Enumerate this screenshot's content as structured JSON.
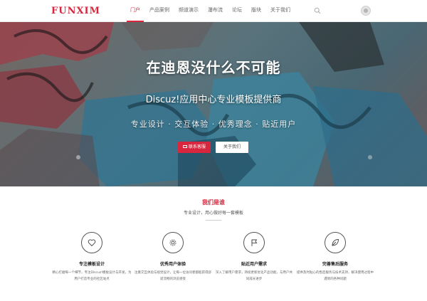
{
  "header": {
    "logo": "FUNXIM",
    "nav": [
      {
        "label": "门户",
        "active": true
      },
      {
        "label": "产品案例",
        "active": false
      },
      {
        "label": "频道演示",
        "active": false
      },
      {
        "label": "瀑布流",
        "active": false
      },
      {
        "label": "论坛",
        "active": false
      },
      {
        "label": "版块",
        "active": false
      },
      {
        "label": "关于我们",
        "active": false
      }
    ],
    "search_icon": "search-icon",
    "avatar_icon": "avatar"
  },
  "hero": {
    "title": "在迪恩没什么不可能",
    "subtitle": "Discuz!应用中心专业模板提供商",
    "tags": "专业设计 · 交互体验 · 优秀理念 · 贴近用户",
    "contact_button": "联系客服",
    "about_button": "关于我们"
  },
  "section": {
    "title": "我们是谁",
    "description": "专业设计，用心做好每一套模板",
    "features": [
      {
        "icon": "heart-icon",
        "title": "专注模板设计",
        "text": "精心打磨每一个细节，专注Discuz!模板设计与开发，为用户打造专业的社区站点"
      },
      {
        "icon": "gear-icon",
        "title": "优秀用户体验",
        "text": "注重交互体验与视觉设计，让每一位访问者都能获得舒适流畅的浏览感受"
      },
      {
        "icon": "flag-icon",
        "title": "贴近用户需求",
        "text": "深入了解用户需求，持续更新优化产品功能，与用户共同成长进步"
      },
      {
        "icon": "leaf-icon",
        "title": "完善售后服务",
        "text": "提供及时贴心的售后服务与技术支持，解决使用过程中遇到的各种问题"
      }
    ]
  },
  "colors": {
    "accent": "#d7263d",
    "nav_text": "#666666",
    "hero_text": "#ffffff"
  }
}
